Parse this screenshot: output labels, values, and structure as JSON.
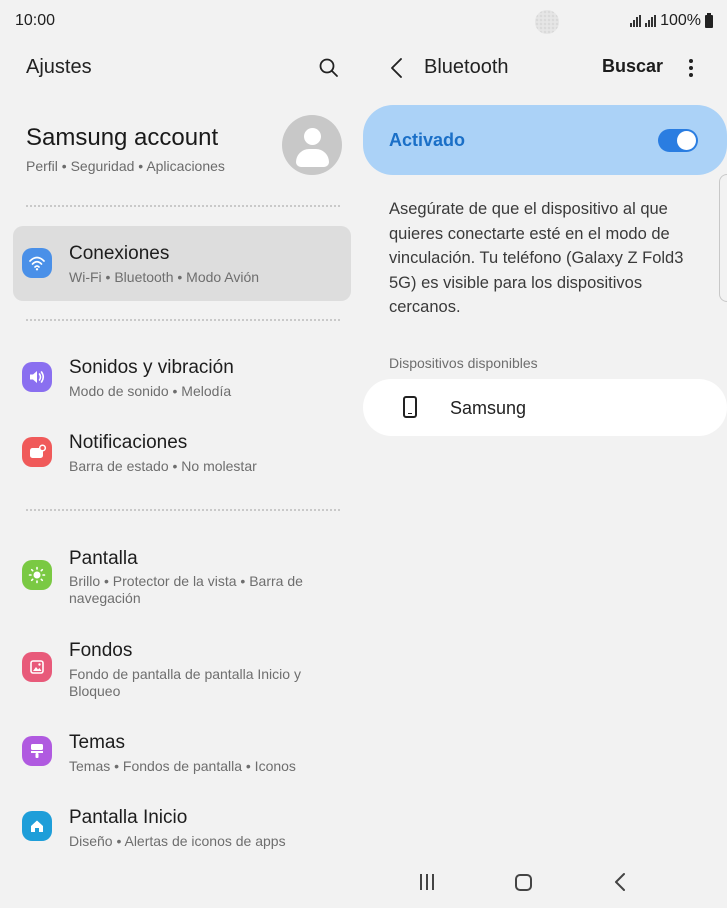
{
  "status_bar": {
    "time": "10:00",
    "battery": "100%",
    "icons": [
      "camera-cutout",
      "signal-icon",
      "signal-icon",
      "battery-icon"
    ]
  },
  "left_pane": {
    "title": "Ajustes",
    "account": {
      "name": "Samsung account",
      "subtitle": "Perfil  •  Seguridad  •  Aplicaciones"
    },
    "items": [
      {
        "title": "Conexiones",
        "subtitle": "Wi-Fi  •  Bluetooth  •  Modo Avión",
        "icon": "wifi-icon",
        "color": "#4a90e8",
        "selected": true
      },
      {
        "title": "Sonidos y vibración",
        "subtitle": "Modo de sonido  •  Melodía",
        "icon": "volume-icon",
        "color": "#8a6ff0",
        "selected": false
      },
      {
        "title": "Notificaciones",
        "subtitle": "Barra de estado  •  No molestar",
        "icon": "notification-icon",
        "color": "#f05a5a",
        "selected": false
      },
      {
        "title": "Pantalla",
        "subtitle": "Brillo  •  Protector de la vista  •  Barra de navegación",
        "icon": "brightness-icon",
        "color": "#7ac943",
        "selected": false
      },
      {
        "title": "Fondos",
        "subtitle": "Fondo de pantalla de pantalla Inicio y Bloqueo",
        "icon": "wallpaper-icon",
        "color": "#e85a7a",
        "selected": false
      },
      {
        "title": "Temas",
        "subtitle": "Temas  •  Fondos de pantalla  •  Iconos",
        "icon": "themes-icon",
        "color": "#b05ae0",
        "selected": false
      },
      {
        "title": "Pantalla Inicio",
        "subtitle": "Diseño  •  Alertas de iconos de apps",
        "icon": "home-screen-icon",
        "color": "#1e9ed9",
        "selected": false
      }
    ]
  },
  "right_pane": {
    "title": "Bluetooth",
    "search_label": "Buscar",
    "toggle": {
      "label": "Activado",
      "on": true,
      "accent": "#2a7de1"
    },
    "info": "Asegúrate de que el dispositivo al que quieres conectarte esté en el modo de vinculación. Tu teléfono (Galaxy Z Fold3 5G) es visible para los dispositivos cercanos.",
    "section_label": "Dispositivos disponibles",
    "devices": [
      {
        "name": "Samsung",
        "icon": "phone-icon"
      }
    ]
  },
  "nav_bar": {
    "buttons": [
      "recents-button",
      "home-button",
      "back-button"
    ]
  }
}
